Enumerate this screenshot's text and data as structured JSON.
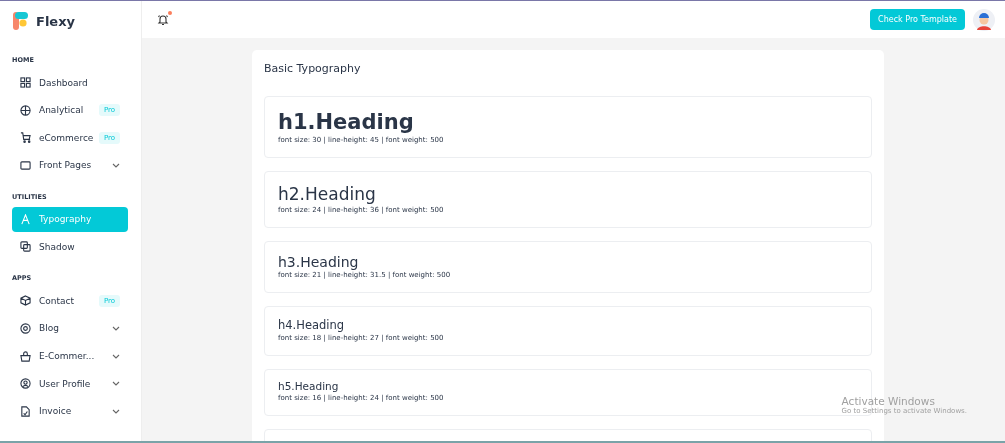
{
  "brand": {
    "name": "Flexy"
  },
  "sidebar": {
    "sections": [
      {
        "title": "HOME",
        "items": [
          {
            "label": "Dashboard",
            "kind": "plain",
            "selected": false
          },
          {
            "label": "Analytical",
            "kind": "badge",
            "badge": "Pro",
            "selected": false
          },
          {
            "label": "eCommerce",
            "kind": "badge",
            "badge": "Pro",
            "selected": false
          },
          {
            "label": "Front Pages",
            "kind": "dropdown",
            "selected": false
          }
        ]
      },
      {
        "title": "UTILITIES",
        "items": [
          {
            "label": "Typography",
            "kind": "plain",
            "selected": true
          },
          {
            "label": "Shadow",
            "kind": "plain",
            "selected": false
          }
        ]
      },
      {
        "title": "APPS",
        "items": [
          {
            "label": "Contact",
            "kind": "badge",
            "badge": "Pro",
            "selected": false
          },
          {
            "label": "Blog",
            "kind": "dropdown",
            "selected": false
          },
          {
            "label": "E-Commer...",
            "kind": "dropdown",
            "selected": false
          },
          {
            "label": "User Profile",
            "kind": "dropdown",
            "selected": false
          },
          {
            "label": "Invoice",
            "kind": "dropdown",
            "selected": false
          }
        ]
      }
    ]
  },
  "header": {
    "notification": true,
    "button": "Check Pro Template"
  },
  "card": {
    "title": "Basic Typography",
    "samples": [
      {
        "kind": "h1",
        "heading": "h1.Heading",
        "spec": "font size: 30 | line-height: 45 | font weight: 500"
      },
      {
        "kind": "h2",
        "heading": "h2.Heading",
        "spec": "font size: 24 | line-height: 36 | font weight: 500"
      },
      {
        "kind": "h3",
        "heading": "h3.Heading",
        "spec": "font size: 21 | line-height: 31.5 | font weight: 500"
      },
      {
        "kind": "h4",
        "heading": "h4.Heading",
        "spec": "font size: 18 | line-height: 27 | font weight: 500"
      },
      {
        "kind": "h5",
        "heading": "h5.Heading",
        "spec": "font size: 16 | line-height: 24 | font weight: 500"
      }
    ]
  },
  "os_notice": {
    "title": "Activate Windows",
    "text": "Go to Settings to activate Windows."
  }
}
